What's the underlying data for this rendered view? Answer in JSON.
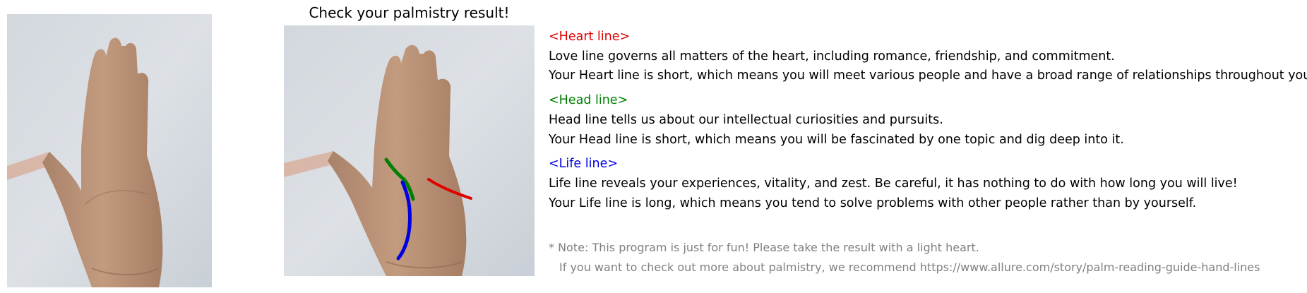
{
  "title": "Check your palmistry result!",
  "colors": {
    "heart": "#e00000",
    "head": "#008000",
    "life": "#0000e0",
    "note": "#808080"
  },
  "icons": {
    "left_image": "hand-photo-icon",
    "right_image": "hand-with-lines-photo-icon"
  },
  "heart": {
    "header": "<Heart line>",
    "desc": "Love line governs all matters of the heart, including romance, friendship, and commitment.",
    "result": "Your Heart line is short, which means you will meet various people and have a broad range of relationships throughout your life."
  },
  "head": {
    "header": "<Head line>",
    "desc": "Head line tells us about our intellectual curiosities and pursuits.",
    "result": "Your Head line is short, which means you will be fascinated by one topic and dig deep into it."
  },
  "life": {
    "header": "<Life line>",
    "desc": "Life line reveals your experiences, vitality, and zest. Be careful, it has nothing to do with how long you will live!",
    "result": "Your Life line is long, which means you tend to solve problems with other people rather than by yourself."
  },
  "note": {
    "line1": "* Note: This program is just for fun! Please take the result with a light heart.",
    "line2": "If you want to check out more about palmistry, we recommend https://www.allure.com/story/palm-reading-guide-hand-lines"
  }
}
